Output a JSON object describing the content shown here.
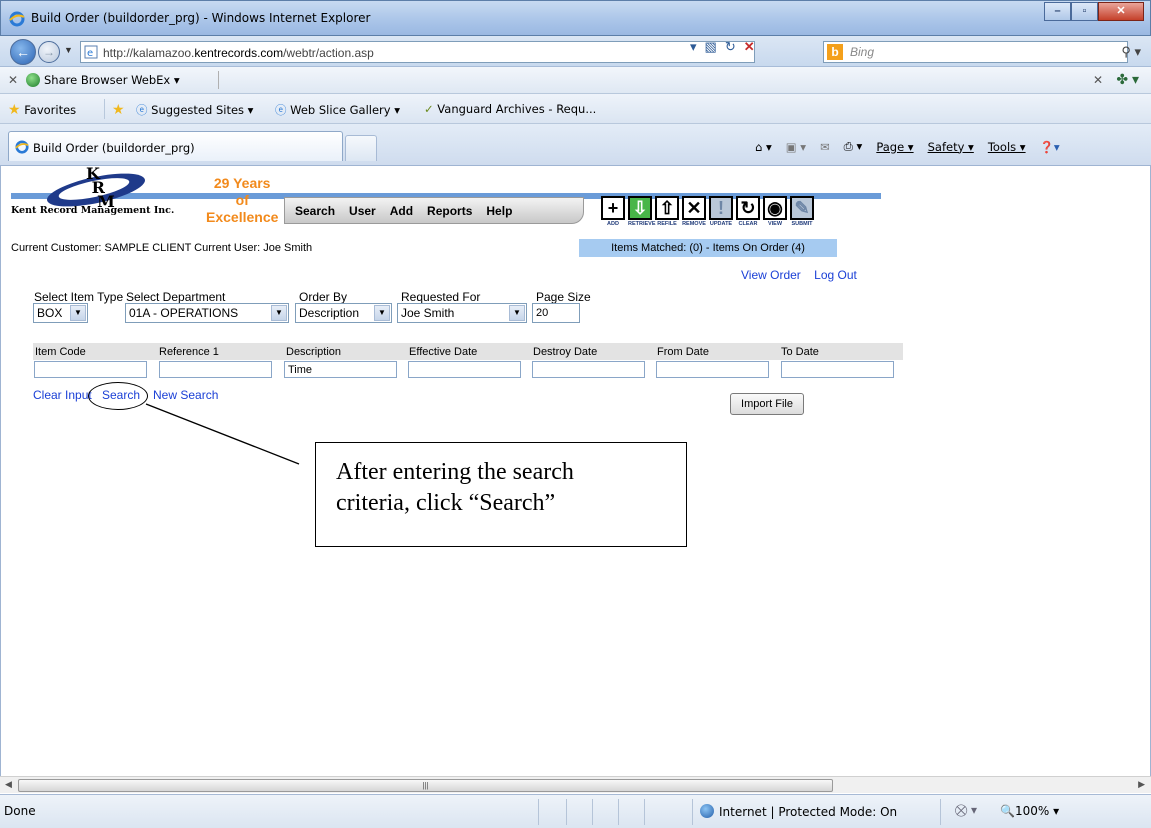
{
  "window": {
    "title": "Build Order (buildorder_prg) - Windows Internet Explorer",
    "url_prefix": "http://kalamazoo.",
    "url_domain": "kentrecords.com",
    "url_suffix": "/webtr/action.asp",
    "search_placeholder": "Bing"
  },
  "share_bar": {
    "label": "Share Browser   WebEx ▾"
  },
  "favorites": {
    "favorites_label": "Favorites",
    "items": [
      "Suggested Sites ▾",
      "Web Slice Gallery ▾",
      "Vanguard Archives - Requ..."
    ]
  },
  "tab": {
    "label": "Build Order (buildorder_prg)"
  },
  "command_bar": {
    "page": "Page ▾",
    "safety": "Safety ▾",
    "tools": "Tools ▾"
  },
  "app": {
    "logo_letters": "K\nR\nM",
    "company": "Kent Record Management Inc.",
    "tagline_1": "29 Years of",
    "tagline_2": "Excellence",
    "menu": [
      "Search",
      "User",
      "Add",
      "Reports",
      "Help"
    ],
    "toolbar": [
      {
        "icon": "add-icon",
        "glyph": "+",
        "caption": "ADD"
      },
      {
        "icon": "retrieve-icon",
        "glyph": "⇩",
        "caption": "RETRIEVE"
      },
      {
        "icon": "refile-icon",
        "glyph": "⇧",
        "caption": "REFILE"
      },
      {
        "icon": "remove-icon",
        "glyph": "✕",
        "caption": "REMOVE"
      },
      {
        "icon": "update-icon",
        "glyph": "!",
        "caption": "UPDATE"
      },
      {
        "icon": "clear-icon",
        "glyph": "↻",
        "caption": "CLEAR"
      },
      {
        "icon": "view-icon",
        "glyph": "◉",
        "caption": "VIEW"
      },
      {
        "icon": "submit-icon",
        "glyph": "✎",
        "caption": "SUBMIT"
      }
    ],
    "current_info": "Current Customer:  SAMPLE CLIENT   Current User:  Joe Smith",
    "items_status": "Items Matched: (0) - Items On Order (4)",
    "links": {
      "view_order": "View Order",
      "log_out": "Log Out"
    }
  },
  "filters": {
    "item_type": {
      "label": "Select Item Type",
      "value": "BOX"
    },
    "department": {
      "label": "Select Department",
      "value": "01A - OPERATIONS"
    },
    "order_by": {
      "label": "Order By",
      "value": "Description"
    },
    "requested_for": {
      "label": "Requested For",
      "value": "Joe Smith"
    },
    "page_size": {
      "label": "Page Size",
      "value": "20"
    }
  },
  "search_fields": {
    "headers": [
      "Item Code",
      "Reference 1",
      "Description",
      "Effective Date",
      "Destroy Date",
      "From Date",
      "To Date"
    ],
    "values": [
      "",
      "",
      "Time",
      "",
      "",
      "",
      ""
    ]
  },
  "actions": {
    "clear": "Clear Input",
    "search": "Search",
    "new_search": "New Search",
    "import": "Import File"
  },
  "callout": {
    "line1": "After entering the search",
    "line2": "criteria, click “Search”"
  },
  "status": {
    "done": "Done",
    "zone": "Internet | Protected Mode: On",
    "zoom": "100%"
  }
}
